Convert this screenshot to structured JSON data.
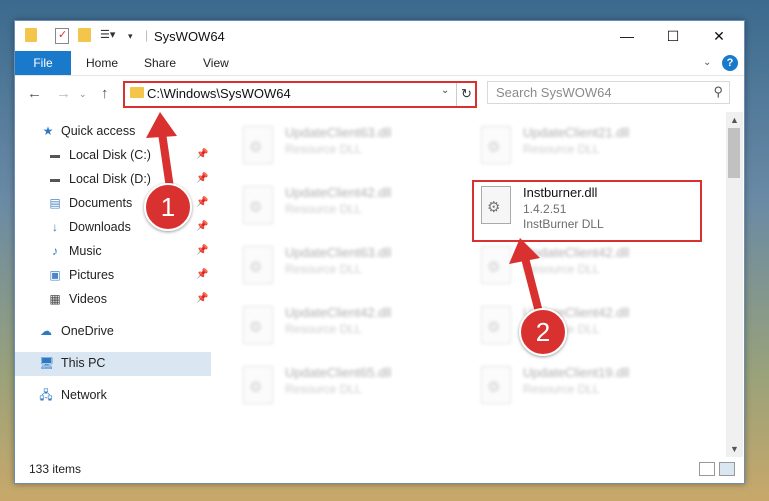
{
  "window": {
    "title": "SysWOW64",
    "min": "—",
    "max": "☐",
    "close": "✕"
  },
  "ribbon": {
    "file": "File",
    "home": "Home",
    "share": "Share",
    "view": "View",
    "help": "?"
  },
  "nav": {
    "back": "←",
    "forward": "→",
    "up": "↑",
    "address": "C:\\Windows\\SysWOW64",
    "search_placeholder": "Search SysWOW64"
  },
  "sidebar": {
    "items": [
      {
        "label": "Quick access"
      },
      {
        "label": "Local Disk (C:)"
      },
      {
        "label": "Local Disk (D:)"
      },
      {
        "label": "Documents"
      },
      {
        "label": "Downloads"
      },
      {
        "label": "Music"
      },
      {
        "label": "Pictures"
      },
      {
        "label": "Videos"
      },
      {
        "label": "OneDrive"
      },
      {
        "label": "This PC"
      },
      {
        "label": "Network"
      }
    ]
  },
  "files": [
    {
      "name": "UpdateClient63.dll",
      "type": "Resource DLL"
    },
    {
      "name": "UpdateClient21.dll",
      "type": "Resource DLL"
    },
    {
      "name": "UpdateClient42.dll",
      "type": "Resource DLL"
    },
    {
      "name": "Instburner.dll",
      "version": "1.4.2.51",
      "type": "InstBurner DLL"
    },
    {
      "name": "UpdateClient63.dll",
      "type": "Resource DLL"
    },
    {
      "name": "UpdateClient42.dll",
      "type": "Resource DLL"
    },
    {
      "name": "UpdateClient42.dll",
      "type": "Resource DLL"
    },
    {
      "name": "UpdateClient42.dll",
      "type": "Resource DLL"
    },
    {
      "name": "UpdateClient65.dll",
      "type": "Resource DLL"
    },
    {
      "name": "UpdateClient19.dll",
      "type": "Resource DLL"
    }
  ],
  "status": {
    "count": "133 items"
  },
  "annotations": {
    "one": "1",
    "two": "2",
    "color": "#d8312f"
  }
}
